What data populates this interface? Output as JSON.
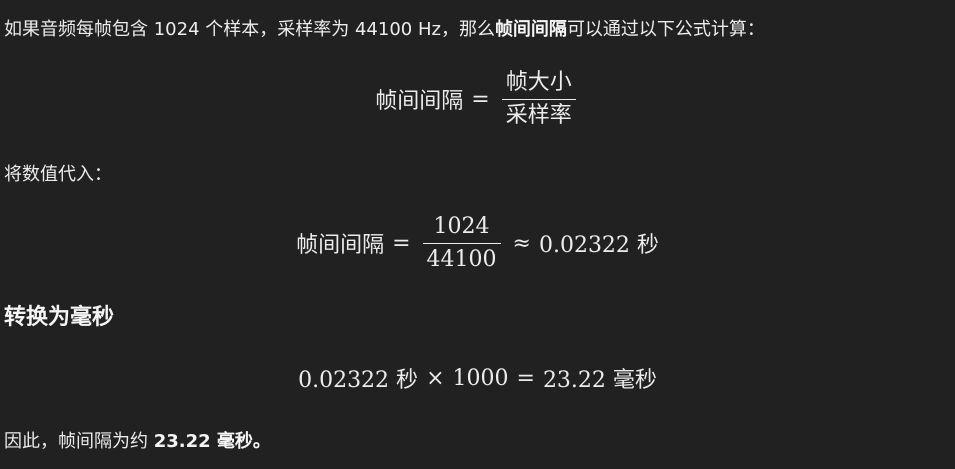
{
  "intro": {
    "text_before": "如果音频每帧包含 1024 个样本，采样率为 44100 Hz，那么",
    "bold": "帧间间隔",
    "text_after": "可以通过以下公式计算："
  },
  "formula1": {
    "lhs": "帧间间隔",
    "eq": "=",
    "numerator": "帧大小",
    "denominator": "采样率"
  },
  "substitute_label": "将数值代入：",
  "formula2": {
    "lhs": "帧间间隔",
    "eq": "=",
    "numerator": "1024",
    "denominator": "44100",
    "approx": "≈",
    "result": "0.02322 秒"
  },
  "convert_heading": "转换为毫秒",
  "formula3": {
    "value": "0.02322 秒",
    "times": "×",
    "factor": "1000",
    "eq": "=",
    "result": "23.22 毫秒"
  },
  "conclusion": {
    "text_before": "因此，帧间隔为约 ",
    "bold": "23.22 毫秒。"
  }
}
